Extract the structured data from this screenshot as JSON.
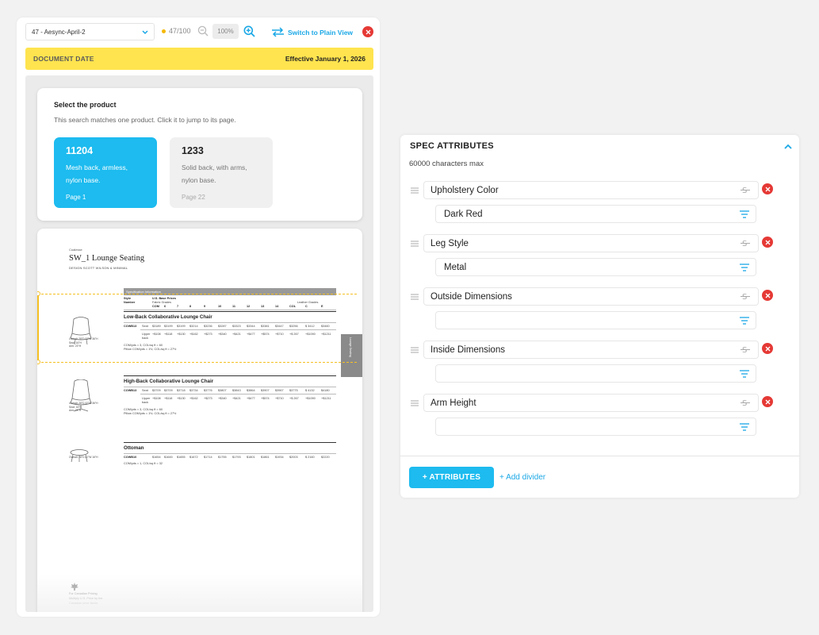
{
  "viewer": {
    "doc_select": "47 - Aesync-April-2",
    "pages": "47/100",
    "zoom": "100%",
    "switch_label": "Switch to Plain View",
    "date_label": "DOCUMENT DATE",
    "date_value": "Effective January 1, 2026"
  },
  "product_select": {
    "title": "Select the product",
    "subtitle": "This search matches one product. Click it to jump to its page.",
    "products": [
      {
        "number": "11204",
        "description": "Mesh back, armless, nylon base.",
        "page": "Page 1",
        "active": true
      },
      {
        "number": "1233",
        "description": "Solid back, with arms, nylon base.",
        "page": "Page 22",
        "active": false
      }
    ]
  },
  "document_page": {
    "brand": "Coalesse",
    "title": "SW_1 Lounge Seating",
    "design": "DESIGN SCOTT WILSON & MINIMAL",
    "spec_header": "Specification Information",
    "col_style": "Style",
    "col_number": "Number",
    "col_prices": "U.S. Base Prices",
    "col_fabric": "Fabric Grades",
    "col_leather": "Leather Grades",
    "grades": [
      "COM",
      "6",
      "7",
      "8",
      "9",
      "10",
      "11",
      "12",
      "13",
      "14",
      "COL",
      "C",
      "E"
    ],
    "side_tab": "Lounge Seating",
    "sections": [
      {
        "title": "Low-Back Collaborative Lounge Chair",
        "code": "COWB13",
        "row1_label": "Seat",
        "row1": [
          "$3189",
          "$3199",
          "$3199",
          "$3214",
          "$3236",
          "$3287",
          "$3323",
          "$3344",
          "$3381",
          "$3447",
          "$3256",
          "$ 3412",
          "$3460"
        ],
        "row2_label": "Upper back",
        "row2": [
          "+$108",
          "+$118",
          "+$130",
          "+$162",
          "+$273",
          "+$340",
          "+$421",
          "+$477",
          "+$574",
          "+$710",
          "+$ 267",
          "+$1090",
          "+$1211"
        ],
        "notes": [
          "COM/yds = 3, COL/sq ft = 60",
          "Pillow COM/yds = 1½, COL/sq ft = 27½"
        ],
        "dims": [
          "Overall: 28\"D 32\"W 36\"H",
          "Seat: 16\"H",
          "Arm: 20\"H"
        ]
      },
      {
        "title": "High-Back Collaborative Lounge Chair",
        "code": "COWB13",
        "row1_label": "Seat",
        "row1": [
          "$3709",
          "$3709",
          "$3718",
          "$3734",
          "$3776",
          "$3807",
          "$3843",
          "$3864",
          "$3907",
          "$3967",
          "$3775",
          "$ 4132",
          "$4180"
        ],
        "row2_label": "Upper back",
        "row2": [
          "+$108",
          "+$118",
          "+$130",
          "+$162",
          "+$273",
          "+$340",
          "+$421",
          "+$477",
          "+$574",
          "+$710",
          "+$ 267",
          "+$1090",
          "+$1211"
        ],
        "notes": [
          "COM/yds = 3, COL/sq ft = 60",
          "Pillow COM/yds = 1½, COL/sq ft = 27½"
        ],
        "dims": [
          "Overall: 28\"D 32\"W 36\"H",
          "Seat: 16\"H",
          "Arm: 20\"H"
        ]
      },
      {
        "title": "Ottoman",
        "code": "COWB10",
        "row1_label": "",
        "row1": [
          "$1654",
          "$1645",
          "$1655",
          "$1672",
          "$1714",
          "$1755",
          "$1793",
          "$1801",
          "$1861",
          "$1934",
          "$2003",
          "$ 2160",
          "$2220"
        ],
        "notes": [
          "COM/yds = 1, COL/sq ft = 32"
        ],
        "dims": [
          "Overall: 28\"D 22\"W 16\"H"
        ]
      }
    ],
    "footer": [
      "For Canadian Pricing",
      "Multiply U.S. Price by the",
      "Canadian price factor."
    ]
  },
  "spec_panel": {
    "title": "SPEC ATTRIBUTES",
    "char_limit": "60000 characters max",
    "attributes": [
      {
        "name": "Upholstery Color",
        "value": "Dark Red"
      },
      {
        "name": "Leg Style",
        "value": "Metal"
      },
      {
        "name": "Outside Dimensions",
        "value": ""
      },
      {
        "name": "Inside Dimensions",
        "value": ""
      },
      {
        "name": "Arm Height",
        "value": ""
      }
    ],
    "add_button": "+ ATTRIBUTES",
    "add_divider": "+ Add divider"
  },
  "colors": {
    "accent": "#1dbbef",
    "highlight": "#ffe44f",
    "danger": "#e53935"
  }
}
